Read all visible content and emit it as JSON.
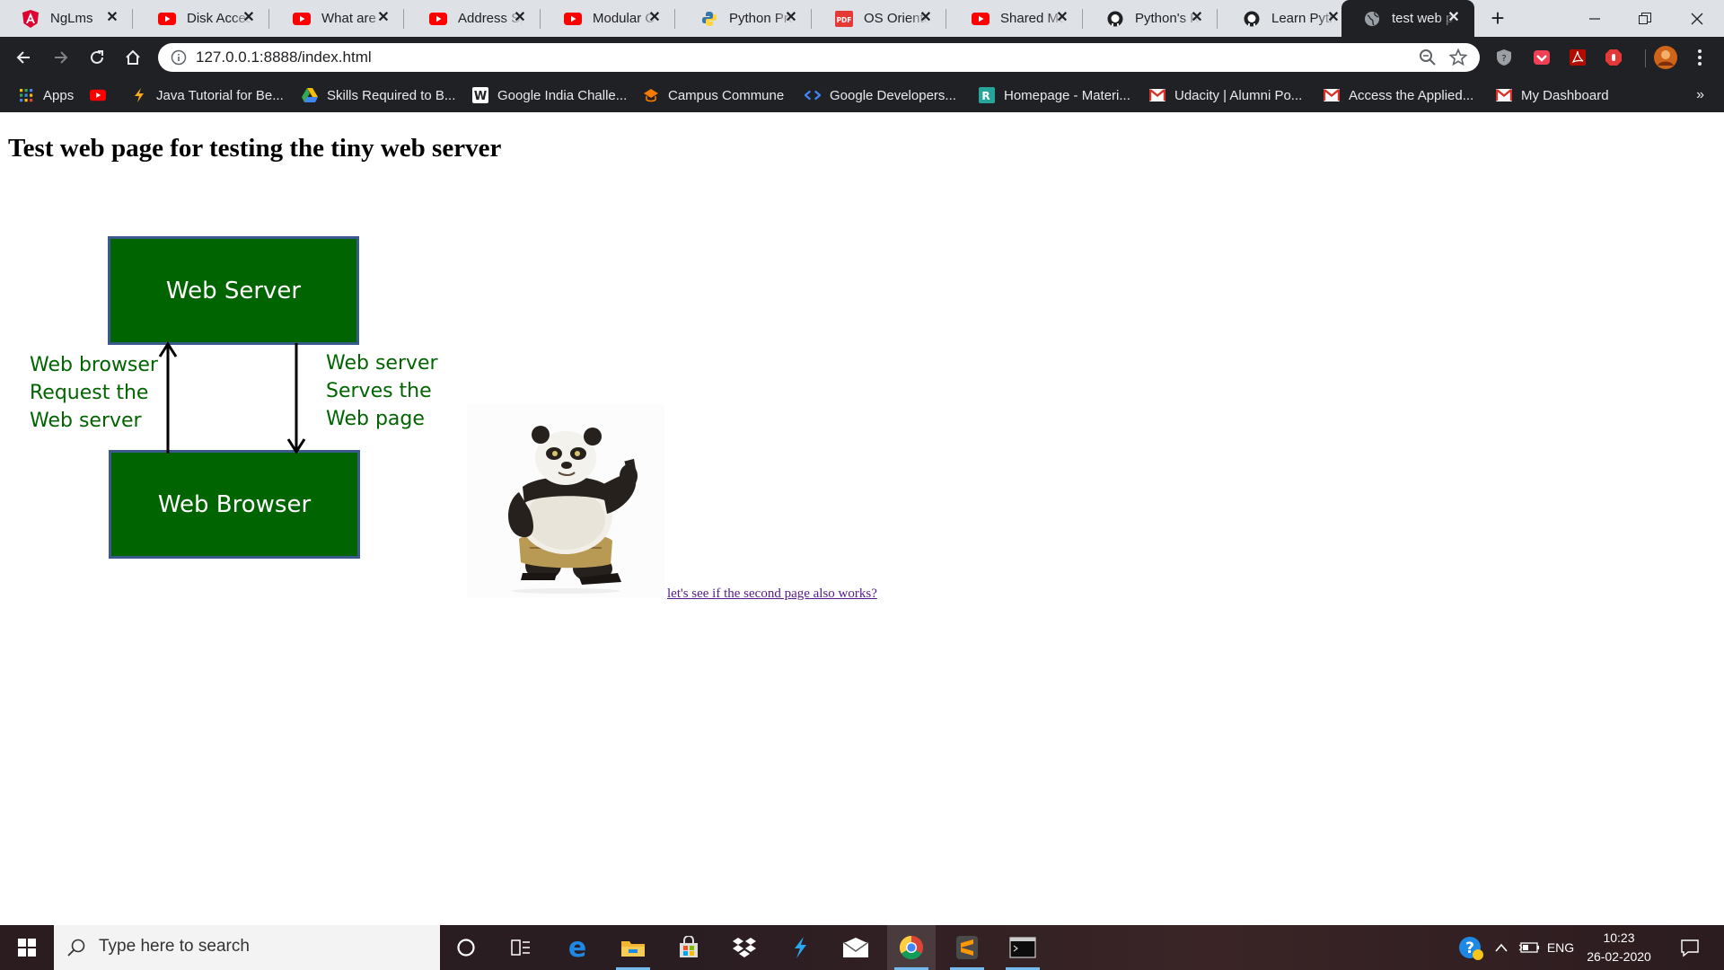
{
  "browser": {
    "tabs": [
      {
        "title": "NgLms",
        "icon": "angular-icon",
        "active": false
      },
      {
        "title": "Disk Access",
        "icon": "youtube-icon",
        "active": false
      },
      {
        "title": "What are ",
        "icon": "youtube-icon",
        "active": false
      },
      {
        "title": "Address Sp",
        "icon": "youtube-icon",
        "active": false
      },
      {
        "title": "Modular C",
        "icon": "youtube-icon",
        "active": false
      },
      {
        "title": "Python Pro",
        "icon": "python-icon",
        "active": false
      },
      {
        "title": "OS Oriente",
        "icon": "pdf-icon",
        "active": false
      },
      {
        "title": "Shared Me",
        "icon": "youtube-icon",
        "active": false
      },
      {
        "title": "Python's R",
        "icon": "github-icon",
        "active": false
      },
      {
        "title": "Learn Pyth",
        "icon": "github-icon",
        "active": false
      },
      {
        "title": "test web p",
        "icon": "globe-icon",
        "active": true
      }
    ],
    "new_tab": "+",
    "url": "127.0.0.1:8888/index.html",
    "bookmarks": [
      {
        "label": "Apps",
        "icon": "apps-grid-icon"
      },
      {
        "label": "",
        "icon": "youtube-icon"
      },
      {
        "label": "Java Tutorial for Be...",
        "icon": "bolt-bookmark-icon"
      },
      {
        "label": "Skills Required to B...",
        "icon": "google-drive-icon"
      },
      {
        "label": "Google India Challe...",
        "icon": "w-icon"
      },
      {
        "label": "Campus Commune",
        "icon": "campus-icon"
      },
      {
        "label": "Google Developers...",
        "icon": "google-developers-icon"
      },
      {
        "label": "Homepage - Materi...",
        "icon": "r-icon"
      },
      {
        "label": "Udacity | Alumni Po...",
        "icon": "gmail-icon"
      },
      {
        "label": "Access the Applied...",
        "icon": "gmail-icon"
      },
      {
        "label": "My Dashboard",
        "icon": "gmail-icon"
      }
    ],
    "bookmarks_overflow": "»"
  },
  "page": {
    "heading": "Test web page for testing the tiny web server",
    "diagram": {
      "server_box": "Web Server",
      "browser_box": "Web Browser",
      "left_label": "Web browser\nRequest the\nWeb server",
      "right_label": "Web server\nServes the\nWeb page",
      "colors": {
        "box_fill": "#006400",
        "box_border": "#3a5a8c",
        "label_text": "#006400"
      }
    },
    "image": "kung-fu-panda",
    "link_text": "let's see if the second page also works?"
  },
  "taskbar": {
    "search_placeholder": "Type here to search",
    "apps": [
      "cortana-icon",
      "task-view-icon",
      "edge-icon",
      "file-explorer-icon",
      "store-icon",
      "dropbox-icon",
      "vscode-icon",
      "mail-icon",
      "chrome-icon",
      "sublime-text-icon",
      "terminal-icon"
    ],
    "language": "ENG",
    "time": "10:23",
    "date": "26-02-2020"
  }
}
